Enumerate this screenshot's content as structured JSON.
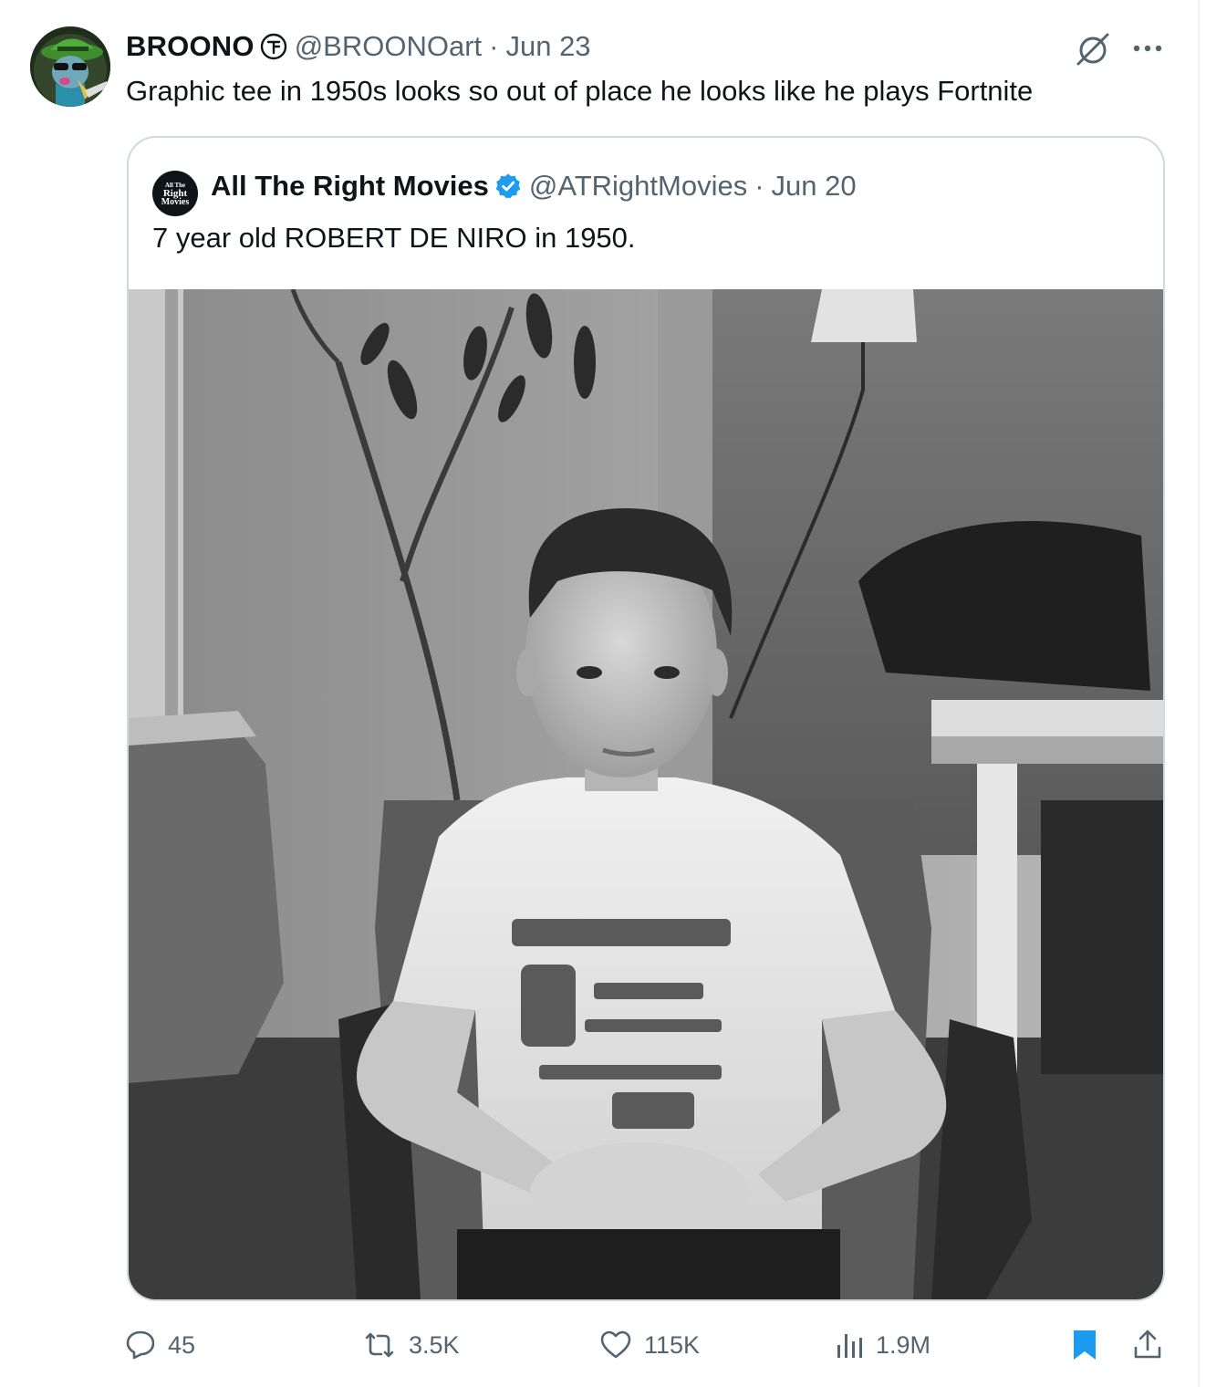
{
  "tweet": {
    "author": {
      "display_name": "BROONO",
      "handle": "@BROONOart",
      "separator": "·",
      "date": "Jun 23",
      "badge_icon": "affiliation-badge-icon"
    },
    "text": "Graphic tee in 1950s looks so out of place he looks like he plays Fortnite"
  },
  "quoted_tweet": {
    "avatar_lines": [
      "All The",
      "Right",
      "Movies"
    ],
    "display_name": "All The Right Movies",
    "verified_icon": "verified-badge-icon",
    "verified_color": "#1d9bf0",
    "handle": "@ATRightMovies",
    "separator": "·",
    "date": "Jun 20",
    "text": "7 year old ROBERT DE NIRO in 1950.",
    "media": "black-and-white photo of a boy in a graphic tee seated in a chair"
  },
  "actions": {
    "reply_count": "45",
    "repost_count": "3.5K",
    "like_count": "115K",
    "view_count": "1.9M",
    "bookmark_color": "#1d9bf0",
    "icons": [
      "reply-icon",
      "repost-icon",
      "like-icon",
      "views-icon",
      "bookmark-icon",
      "share-icon"
    ]
  },
  "colors": {
    "text_primary": "#0f1419",
    "text_secondary": "#536471",
    "border": "#cfd9de",
    "accent": "#1d9bf0"
  }
}
